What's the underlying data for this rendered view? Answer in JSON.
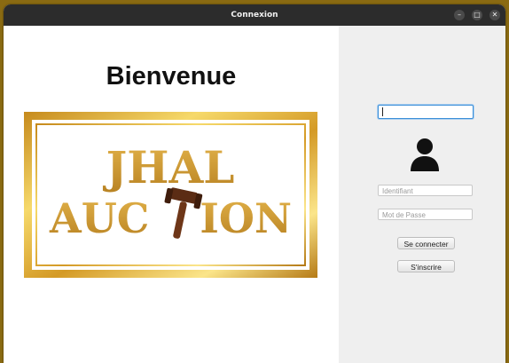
{
  "window": {
    "title": "Connexion",
    "controls": [
      "–",
      "□",
      "✕"
    ]
  },
  "welcome": {
    "heading": "Bienvenue"
  },
  "logo": {
    "line1": "JHAL",
    "line2_start": "AUC",
    "line2_end": "ION"
  },
  "login": {
    "username_placeholder": "Identifiant",
    "password_placeholder": "Mot de Passe",
    "login_button": "Se connecter",
    "register_button": "S'inscrire"
  },
  "colors": {
    "titlebar": "#2c2c2c",
    "right_panel": "#efefef",
    "focus_border": "#3b8fd8",
    "logo_gold": "#c9962a"
  }
}
